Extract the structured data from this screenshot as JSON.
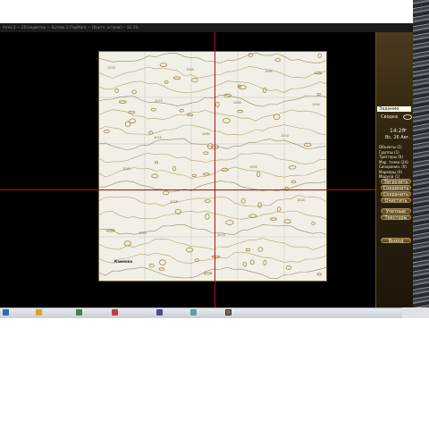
{
  "window": {
    "title": "Arma 3 — 2D-редактор — Бутово 3 (ТерМап) — [Карта: остров] — 82.3%"
  },
  "panel": {
    "header": "Задание",
    "intel_label": "Сводка",
    "time": "14:20",
    "time_suffix": "00",
    "date": "Вс, 26 Авг.",
    "counts": [
      "Объекты (1)",
      "Группы (1)",
      "Триггеры (0)",
      "Мар. точки (24)",
      "Синхрониз. (0)",
      "Маркеры (0)",
      "Модули (1)"
    ],
    "buttons": [
      "Загрузить",
      "Соединить",
      "Сохранить",
      "Очистить",
      "Учетные",
      "Текстуры",
      "Выход"
    ]
  },
  "map": {
    "town_label": "Каменка",
    "elevation_labels": [
      "1030",
      "1075",
      "1060",
      "1055",
      "1040",
      "1035",
      "1085",
      "1080",
      "1010",
      "1045",
      "1025",
      "1070",
      "1065",
      "1090",
      "1015"
    ]
  },
  "colors": {
    "contour": "#a48848",
    "contour_dark": "#7a6a3a",
    "grid": "#8a8a8a",
    "crosshair": "#b01010"
  },
  "taskbar": {
    "icons": [
      "start-icon",
      "explorer-icon",
      "browser-icon",
      "mail-icon",
      "media-icon",
      "folder-icon",
      "game-icon"
    ]
  }
}
